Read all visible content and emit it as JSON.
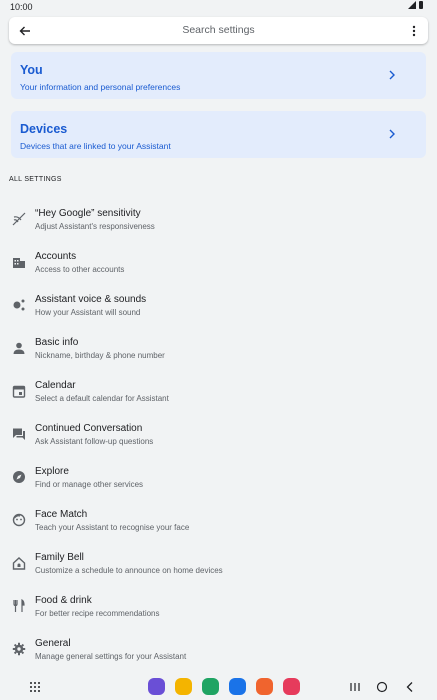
{
  "status": {
    "time": "10:00"
  },
  "search": {
    "placeholder": "Search settings"
  },
  "cards": [
    {
      "title": "You",
      "subtitle": "Your information and personal preferences"
    },
    {
      "title": "Devices",
      "subtitle": "Devices that are linked to your Assistant"
    }
  ],
  "section_header": "ALL SETTINGS",
  "settings": [
    {
      "title": "“Hey Google” sensitivity",
      "subtitle": "Adjust Assistant's responsiveness",
      "icon": "voice-sensitivity-icon"
    },
    {
      "title": "Accounts",
      "subtitle": "Access to other accounts",
      "icon": "accounts-icon"
    },
    {
      "title": "Assistant voice & sounds",
      "subtitle": "How your Assistant will sound",
      "icon": "voice-sounds-icon"
    },
    {
      "title": "Basic info",
      "subtitle": "Nickname, birthday & phone number",
      "icon": "person-icon"
    },
    {
      "title": "Calendar",
      "subtitle": "Select a default calendar for Assistant",
      "icon": "calendar-icon"
    },
    {
      "title": "Continued Conversation",
      "subtitle": "Ask Assistant follow-up questions",
      "icon": "conversation-icon"
    },
    {
      "title": "Explore",
      "subtitle": "Find or manage other services",
      "icon": "compass-icon"
    },
    {
      "title": "Face Match",
      "subtitle": "Teach your Assistant to recognise your face",
      "icon": "face-icon"
    },
    {
      "title": "Family Bell",
      "subtitle": "Customize a schedule to announce on home devices",
      "icon": "home-bell-icon"
    },
    {
      "title": "Food & drink",
      "subtitle": "For better recipe recommendations",
      "icon": "cutlery-icon"
    },
    {
      "title": "General",
      "subtitle": "Manage general settings for your Assistant",
      "icon": "gear-icon"
    }
  ],
  "dock_apps": [
    "bixby-app-icon",
    "files-app-icon",
    "phone-app-icon",
    "messages-app-icon",
    "contacts-app-icon",
    "camera-app-icon"
  ],
  "colors": {
    "accent": "#1a5bd1",
    "card_bg": "#e3ecfc",
    "page_bg": "#f1f3f4"
  }
}
